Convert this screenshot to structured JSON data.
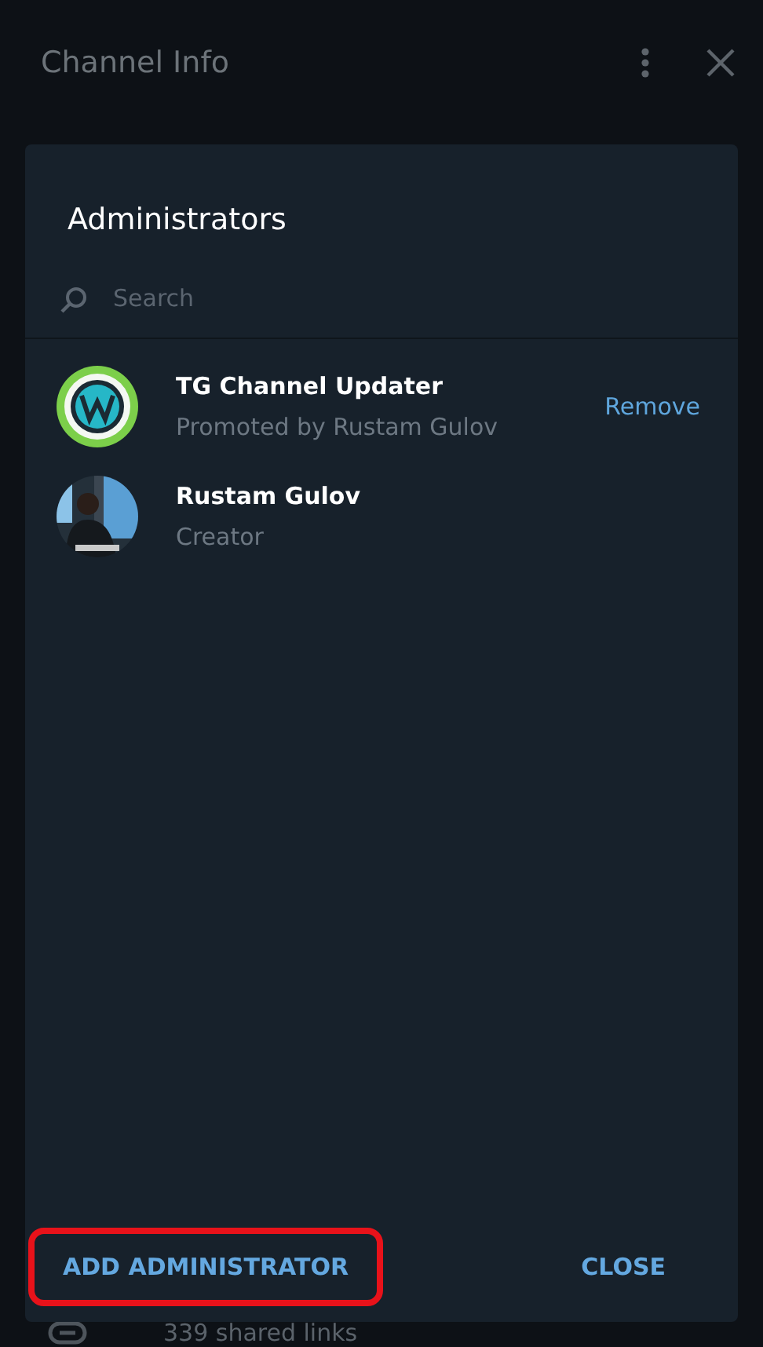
{
  "panel": {
    "title": "Channel Info"
  },
  "background_row": {
    "text": "339 shared links"
  },
  "dialog": {
    "title": "Administrators",
    "search": {
      "placeholder": "Search"
    },
    "members": [
      {
        "name": "TG Channel Updater",
        "status": "Promoted by Rustam Gulov",
        "action": "Remove",
        "kind": "logo"
      },
      {
        "name": "Rustam Gulov",
        "status": "Creator",
        "kind": "picture"
      }
    ],
    "buttons": [
      {
        "label": "ADD ADMINISTRATOR",
        "highlighted": true
      },
      {
        "label": "CLOSE",
        "highlighted": false
      }
    ]
  }
}
